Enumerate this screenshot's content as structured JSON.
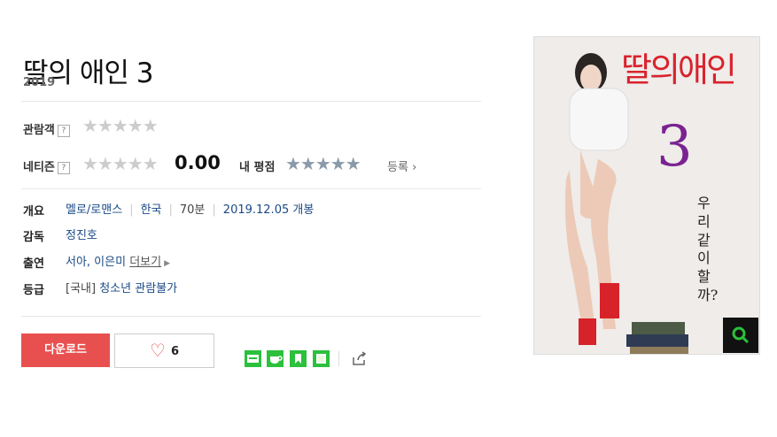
{
  "movie": {
    "title": "딸의 애인 3",
    "year": "2019"
  },
  "ratings": {
    "audience_label": "관람객",
    "audience_stars": "★★★★★",
    "netizen_label": "네티즌",
    "netizen_stars": "★★★★★",
    "netizen_score": "0.00",
    "my_rating_label": "내 평점",
    "my_rating_stars": "★★★★★",
    "register_label": "등록",
    "help_glyph": "?"
  },
  "info": {
    "overview_label": "개요",
    "genre": "멜로/로맨스",
    "country": "한국",
    "runtime": "70분",
    "release": "2019.12.05 개봉",
    "director_label": "감독",
    "director": "정진호",
    "cast_label": "출연",
    "cast": "서아, 이은미",
    "more_label": "더보기",
    "grade_label": "등급",
    "grade_prefix": "[국내]",
    "grade": "청소년 관람불가"
  },
  "actions": {
    "download_label": "다운로드",
    "like_count": "6"
  },
  "poster": {
    "title_text": "딸의애인",
    "number": "3",
    "tagline": "우리 같이 할까?"
  },
  "colors": {
    "accent_red": "#e8504f",
    "link_blue": "#1a4a86",
    "share_green": "#2cc03d"
  }
}
